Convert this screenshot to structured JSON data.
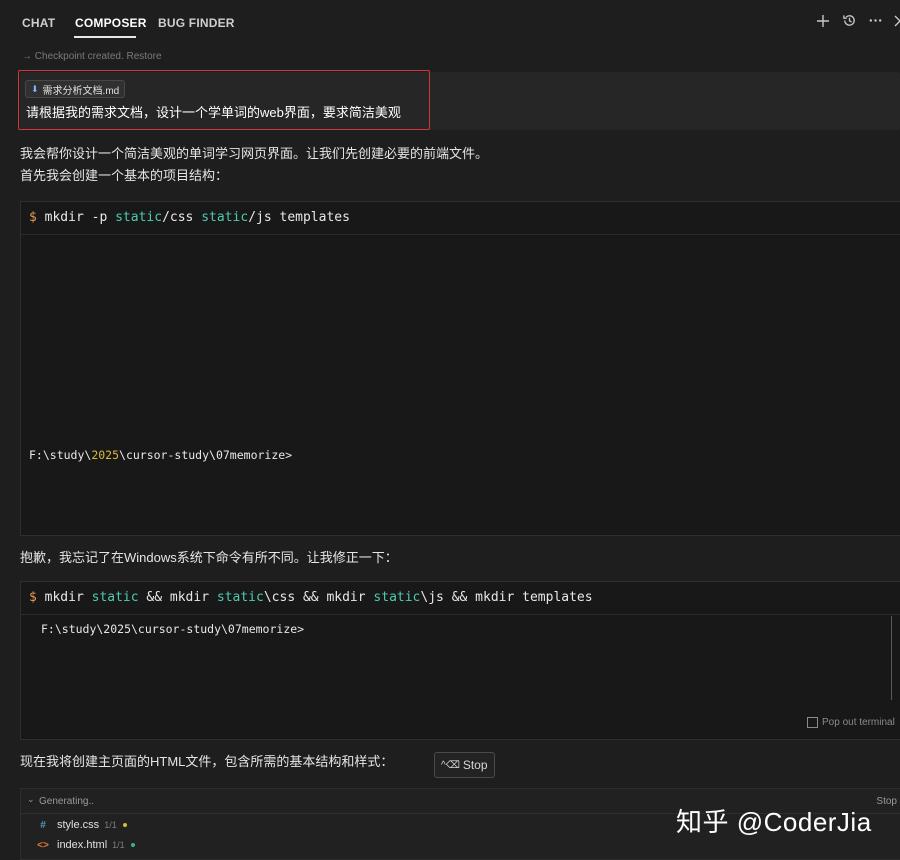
{
  "tabs": {
    "chat": "CHAT",
    "composer": "COMPOSER",
    "bug_finder": "BUG FINDER"
  },
  "toolbar": {
    "new_icon": "plus-icon",
    "history_icon": "history-icon",
    "more_icon": "ellipsis-icon",
    "close_icon": "close-icon"
  },
  "checkpoint1": {
    "arrow": "→",
    "text": "Checkpoint created.",
    "restore": "Restore"
  },
  "user_message": {
    "file_chip": "需求分析文档.md",
    "text": "请根据我的需求文档，设计一个学单词的web界面，要求简洁美观"
  },
  "assistant": {
    "intro_line1": "我会帮你设计一个简洁美观的单词学习网页界面。让我们先创建必要的前端文件。",
    "intro_line2": "首先我会创建一个基本的项目结构：",
    "apology": "抱歉，我忘记了在Windows系统下命令有所不同。让我修正一下：",
    "next_step": "现在我将创建主页面的HTML文件，包含所需的基本结构和样式："
  },
  "terminal1": {
    "prompt": "$",
    "cmd_a": " mkdir -p ",
    "arg1": "static",
    "cmd_b": "/css ",
    "arg2": "static",
    "cmd_c": "/js templates",
    "output_prefix": "F:\\study\\",
    "output_year": "2025",
    "output_suffix": "\\cursor-study\\07memorize>"
  },
  "terminal2": {
    "prompt": "$",
    "cmd_a": " mkdir ",
    "arg1": "static",
    "cmd_b": " && mkdir ",
    "arg2": "static",
    "cmd_c": "\\css && mkdir ",
    "arg3": "static",
    "cmd_d": "\\js && mkdir templates",
    "output": "F:\\study\\2025\\cursor-study\\07memorize>",
    "popout": "Pop out terminal"
  },
  "stop_button": {
    "shortcut": "^⌫",
    "label": "Stop"
  },
  "generating": {
    "label": "Generating..",
    "stop": "Stop",
    "files": [
      {
        "icon": "#",
        "name": "style.css",
        "count": "1/1",
        "dot_color": "#d7ba3c",
        "icon_color": "#519aba"
      },
      {
        "icon": "<>",
        "name": "index.html",
        "count": "1/1",
        "dot_color": "#3fb27f",
        "icon_color": "#e37933"
      }
    ]
  },
  "watermark": "知乎 @CoderJia"
}
